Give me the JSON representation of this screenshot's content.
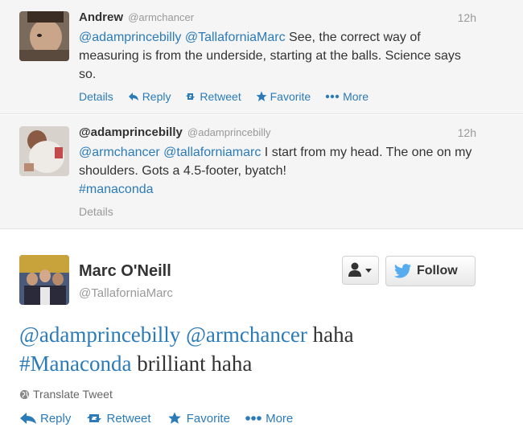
{
  "replies": [
    {
      "fullname": "Andrew",
      "username": "@armchancer",
      "time": "12h",
      "text_mentions": [
        "@adamprincebilly",
        "@TallaforniaMarc"
      ],
      "text_rest": "See, the correct way of measuring is from the underside, starting at the balls. Science says so.",
      "actions": {
        "details": "Details",
        "reply": "Reply",
        "retweet": "Retweet",
        "favorite": "Favorite",
        "more": "More"
      }
    },
    {
      "fullname": "@adamprincebilly",
      "username": "@adamprincebilly",
      "time": "12h",
      "text_mentions": [
        "@armchancer",
        "@tallaforniamarc"
      ],
      "text_rest": "I start from my head. The one on my shoulders. Gots a 4.5-footer, byatch!",
      "hashtag": "#manaconda",
      "actions": {
        "details": "Details"
      }
    }
  ],
  "main": {
    "fullname": "Marc O'Neill",
    "username": "@TallaforniaMarc",
    "follow_label": "Follow",
    "text_mention_1": "@adamprincebilly",
    "text_mention_2": "@armchancer",
    "text_word_1": "haha",
    "hashtag": "#Manaconda",
    "text_word_2": "brilliant haha",
    "translate_label": "Translate Tweet",
    "actions": {
      "reply": "Reply",
      "retweet": "Retweet",
      "favorite": "Favorite",
      "more": "More"
    }
  },
  "colors": {
    "link": "#2b7bb9",
    "muted": "#999999",
    "reply_bg": "#f5f5f5"
  },
  "icons": [
    "reply-icon",
    "retweet-icon",
    "favorite-star-icon",
    "more-dots-icon",
    "globe-icon",
    "user-dropdown-icon",
    "twitter-bird-icon"
  ]
}
